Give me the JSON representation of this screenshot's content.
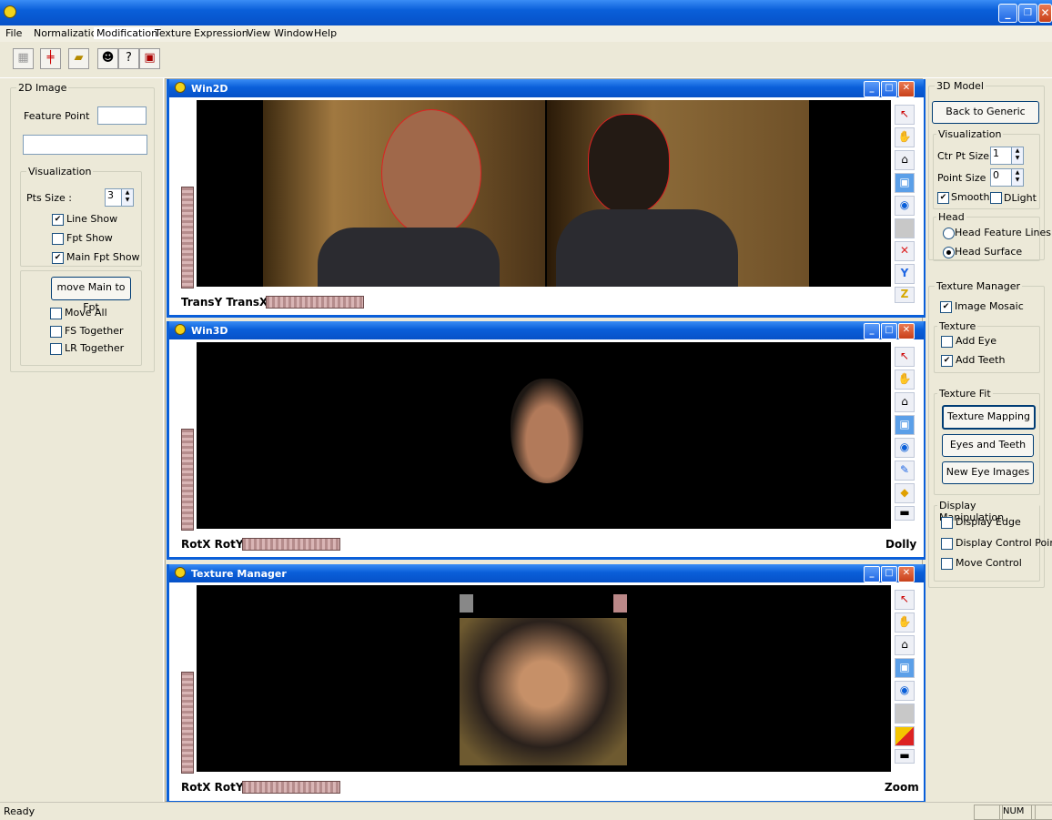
{
  "menu": [
    "File",
    "Normalization",
    "Modification",
    "Texture",
    "Expression",
    "View",
    "Window",
    "Help"
  ],
  "left_panel": {
    "group_title": "2D Image",
    "feature_point_label": "Feature Point",
    "visualization_title": "Visualization",
    "pts_size_label": "Pts Size :",
    "pts_size_value": "3",
    "line_show": "Line Show",
    "fpt_show": "Fpt Show",
    "main_fpt_show": "Main Fpt Show",
    "move_button": "move Main to Fpt",
    "move_all": "Move All",
    "fs_together": "FS Together",
    "lr_together": "LR Together"
  },
  "windows": {
    "win2d": {
      "title": "Win2D",
      "label_left": "TransY  TransX"
    },
    "win3d": {
      "title": "Win3D",
      "label_left": "RotX  RotY",
      "label_right": "Dolly"
    },
    "texture": {
      "title": "Texture Manager",
      "label_left": "RotX  RotY",
      "label_right": "Zoom"
    }
  },
  "right_panel": {
    "model_title": "3D Model",
    "back_button": "Back to Generic",
    "visualization_title": "Visualization",
    "ctr_pt_label": "Ctr Pt Size",
    "ctr_pt_value": "1",
    "point_size_label": "Point Size",
    "point_size_value": "0",
    "smooth": "Smooth",
    "dlight": "DLight",
    "head_title": "Head",
    "head_feature_lines": "Head Feature Lines",
    "head_surface": "Head Surface",
    "texture_manager_title": "Texture Manager",
    "image_mosaic": "Image Mosaic",
    "texture_title": "Texture",
    "add_eye": "Add Eye",
    "add_teeth": "Add Teeth",
    "texture_fit_title": "Texture Fit",
    "texture_mapping": "Texture Mapping",
    "eyes_and_teeth": "Eyes and Teeth",
    "new_eye_images": "New Eye Images",
    "display_manip_title": "Display Manipulation",
    "display_edge": "Display Edge",
    "display_control_point": "Display Control Point",
    "move_control": "Move Control"
  },
  "status": {
    "text": "Ready",
    "num": "NUM"
  }
}
